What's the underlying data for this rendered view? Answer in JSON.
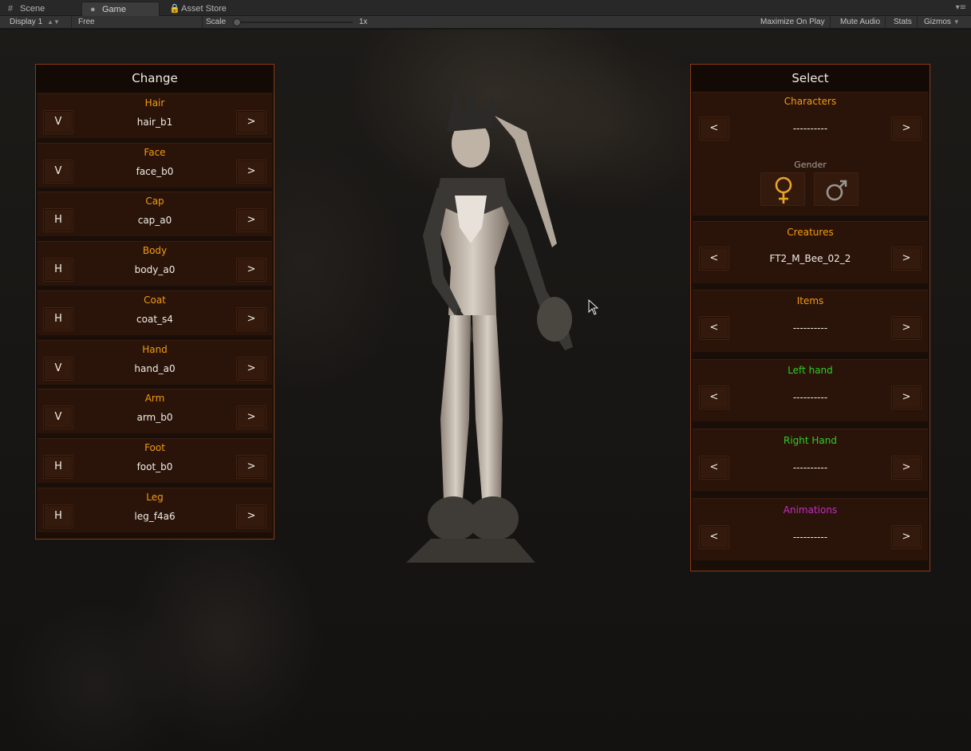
{
  "tabs": [
    {
      "label": "Scene",
      "icon": "grid-icon"
    },
    {
      "label": "Game",
      "icon": "game-icon",
      "active": true
    },
    {
      "label": "Asset Store",
      "icon": "lock-icon"
    }
  ],
  "toolbar": {
    "display": "Display 1",
    "aspect": "Free Aspect",
    "scale_label": "Scale",
    "scale_value": "1x",
    "maximize": "Maximize On Play",
    "mute": "Mute Audio",
    "stats": "Stats",
    "gizmos": "Gizmos"
  },
  "change_panel": {
    "title": "Change",
    "rows": [
      {
        "label": "Hair",
        "toggle": "V",
        "value": "hair_b1",
        "next": ">"
      },
      {
        "label": "Face",
        "toggle": "V",
        "value": "face_b0",
        "next": ">"
      },
      {
        "label": "Cap",
        "toggle": "H",
        "value": "cap_a0",
        "next": ">"
      },
      {
        "label": "Body",
        "toggle": "H",
        "value": "body_a0",
        "next": ">"
      },
      {
        "label": "Coat",
        "toggle": "H",
        "value": "coat_s4",
        "next": ">"
      },
      {
        "label": "Hand",
        "toggle": "V",
        "value": "hand_a0",
        "next": ">"
      },
      {
        "label": "Arm",
        "toggle": "V",
        "value": "arm_b0",
        "next": ">"
      },
      {
        "label": "Foot",
        "toggle": "H",
        "value": "foot_b0",
        "next": ">"
      },
      {
        "label": "Leg",
        "toggle": "H",
        "value": "leg_f4a6",
        "next": ">"
      }
    ]
  },
  "select_panel": {
    "title": "Select",
    "characters": {
      "label": "Characters",
      "value": "----------",
      "prev": "<",
      "next": ">"
    },
    "gender": {
      "label": "Gender",
      "female_icon": "female-symbol-icon",
      "male_icon": "male-symbol-icon"
    },
    "creatures": {
      "label": "Creatures",
      "value": "FT2_M_Bee_02_2",
      "prev": "<",
      "next": ">"
    },
    "items": {
      "label": "Items",
      "value": "----------",
      "prev": "<",
      "next": ">"
    },
    "left_hand": {
      "label": "Left hand",
      "value": "----------",
      "prev": "<",
      "next": ">"
    },
    "right_hand": {
      "label": "Right Hand",
      "value": "----------",
      "prev": "<",
      "next": ">"
    },
    "animations": {
      "label": "Animations",
      "value": "----------",
      "prev": "<",
      "next": ">"
    }
  },
  "colors": {
    "panel_border": "#8a3a12",
    "label_orange": "#f39a10",
    "label_green": "#2fcc28",
    "label_magenta": "#c42dc2",
    "female_symbol": "#e9a52a",
    "male_symbol": "#9a9590"
  }
}
